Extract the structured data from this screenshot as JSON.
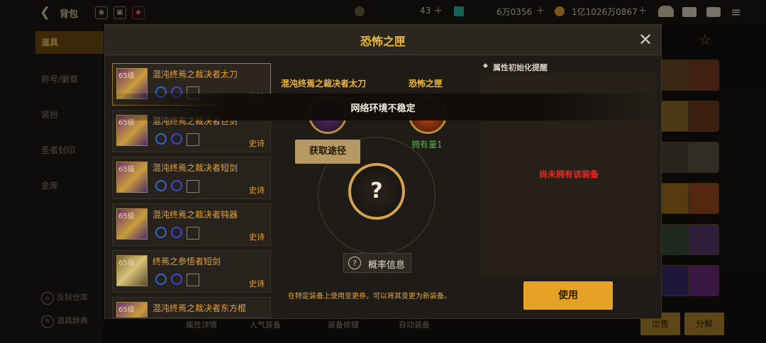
{
  "topbar": {
    "title": "背包",
    "currency_a": "43",
    "currency_b": "6万0356",
    "currency_c": "1亿1026万0867"
  },
  "sidebar": {
    "items": [
      "道具",
      "称号/徽章",
      "装扮",
      "圣者封印",
      "金库"
    ],
    "bottom": [
      "反狱仓库",
      "道具辞典"
    ]
  },
  "bottom_tabs": [
    "属性详情",
    "人气装备",
    "装备修理",
    "自动装备"
  ],
  "bottom_buttons": {
    "sell": "出售",
    "dismantle": "分解"
  },
  "dialog": {
    "title": "恐怖之匣",
    "list": [
      {
        "level": "65级",
        "name": "混沌终焉之裁决者太刀",
        "grade": "史诗"
      },
      {
        "level": "65级",
        "name": "混沌终焉之裁决者巨剑",
        "grade": "史诗"
      },
      {
        "level": "65级",
        "name": "混沌终焉之裁决者短剑",
        "grade": "史诗"
      },
      {
        "level": "65级",
        "name": "混沌终焉之裁决者钝器",
        "grade": "史诗"
      },
      {
        "level": "65级",
        "name": "终焉之参悟者短剑",
        "grade": "史诗"
      },
      {
        "level": "65级",
        "name": "混沌终焉之裁决者东方棍",
        "grade": ""
      }
    ],
    "left_item_label": "混沌终焉之裁决者太刀",
    "right_item_label": "恐怖之匣",
    "get_button": "获取途径",
    "owned": "拥有量1",
    "question_mark": "?",
    "prob_button": "概率信息",
    "prob_icon": "?",
    "hint": "在特定装备上使用变更券，可以将其变更为新装备。",
    "attr_title": "属性初始化提醒",
    "attr_message": "尚未拥有该装备",
    "use_button": "使用"
  },
  "toast": "网络环境不稳定",
  "colors": {
    "accent": "#f0b83a",
    "epic": "#e6a33a",
    "error": "#e52d2d",
    "use_button": "#e6a227"
  }
}
